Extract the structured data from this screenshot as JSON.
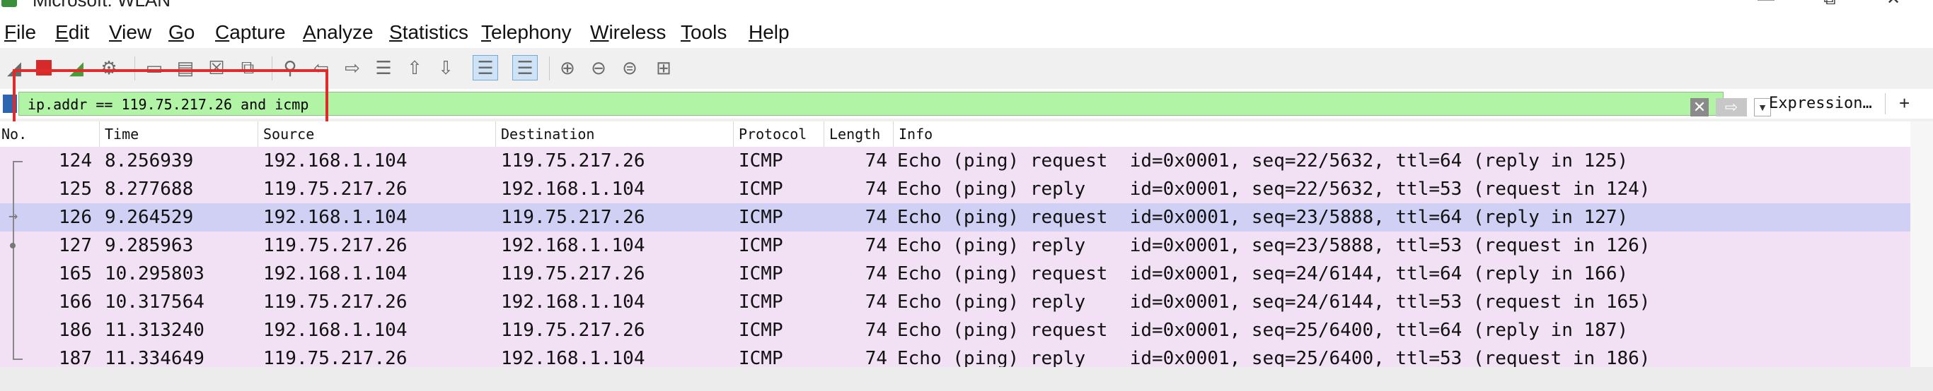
{
  "window": {
    "title": "Microsoft: WLAN",
    "controls": {
      "minimize": "—",
      "maximize": "⧉",
      "close": "✕"
    }
  },
  "menu": [
    "File",
    "Edit",
    "View",
    "Go",
    "Capture",
    "Analyze",
    "Statistics",
    "Telephony",
    "Wireless",
    "Tools",
    "Help"
  ],
  "toolbar": {
    "icons": [
      "shark-fin-start-icon",
      "stop-square-icon",
      "restart-fin-icon",
      "capture-options-gear-icon",
      "open-file-icon",
      "save-file-icon",
      "close-file-icon",
      "reload-file-icon",
      "find-packet-icon",
      "go-back-icon",
      "go-forward-icon",
      "go-to-packet-icon",
      "go-first-icon",
      "go-last-icon",
      "autoscroll-icon",
      "colorize-icon",
      "zoom-in-icon",
      "zoom-out-icon",
      "zoom-normal-icon",
      "resize-columns-icon"
    ],
    "active": [
      "autoscroll-icon",
      "colorize-icon"
    ]
  },
  "filter": {
    "value": "ip.addr == 119.75.217.26 and icmp",
    "expression_label": "Expression…",
    "add_label": "+",
    "background": "#b1f4a5",
    "annotation_color": "#e12a2a"
  },
  "columns": [
    "No.",
    "Time",
    "Source",
    "Destination",
    "Protocol",
    "Length",
    "Info"
  ],
  "packets": [
    {
      "no": "124",
      "time": "8.256939",
      "src": "192.168.1.104",
      "dst": "119.75.217.26",
      "proto": "ICMP",
      "len": "74",
      "info": "Echo (ping) request  id=0x0001, seq=22/5632, ttl=64 (reply in 125)",
      "selected": false,
      "rel": "start"
    },
    {
      "no": "125",
      "time": "8.277688",
      "src": "119.75.217.26",
      "dst": "192.168.1.104",
      "proto": "ICMP",
      "len": "74",
      "info": "Echo (ping) reply    id=0x0001, seq=22/5632, ttl=53 (request in 124)",
      "selected": false,
      "rel": "line"
    },
    {
      "no": "126",
      "time": "9.264529",
      "src": "192.168.1.104",
      "dst": "119.75.217.26",
      "proto": "ICMP",
      "len": "74",
      "info": "Echo (ping) request  id=0x0001, seq=23/5888, ttl=64 (reply in 127)",
      "selected": true,
      "rel": "arrow"
    },
    {
      "no": "127",
      "time": "9.285963",
      "src": "119.75.217.26",
      "dst": "192.168.1.104",
      "proto": "ICMP",
      "len": "74",
      "info": "Echo (ping) reply    id=0x0001, seq=23/5888, ttl=53 (request in 126)",
      "selected": false,
      "rel": "dot"
    },
    {
      "no": "165",
      "time": "10.295803",
      "src": "192.168.1.104",
      "dst": "119.75.217.26",
      "proto": "ICMP",
      "len": "74",
      "info": "Echo (ping) request  id=0x0001, seq=24/6144, ttl=64 (reply in 166)",
      "selected": false,
      "rel": "line"
    },
    {
      "no": "166",
      "time": "10.317564",
      "src": "119.75.217.26",
      "dst": "192.168.1.104",
      "proto": "ICMP",
      "len": "74",
      "info": "Echo (ping) reply    id=0x0001, seq=24/6144, ttl=53 (request in 165)",
      "selected": false,
      "rel": "line"
    },
    {
      "no": "186",
      "time": "11.313240",
      "src": "192.168.1.104",
      "dst": "119.75.217.26",
      "proto": "ICMP",
      "len": "74",
      "info": "Echo (ping) request  id=0x0001, seq=25/6400, ttl=64 (reply in 187)",
      "selected": false,
      "rel": "line"
    },
    {
      "no": "187",
      "time": "11.334649",
      "src": "119.75.217.26",
      "dst": "192.168.1.104",
      "proto": "ICMP",
      "len": "74",
      "info": "Echo (ping) reply    id=0x0001, seq=25/6400, ttl=53 (request in 186)",
      "selected": false,
      "rel": "end"
    }
  ],
  "colors": {
    "row_icmp": "#f2e0f5",
    "row_selected": "#cfd0f4"
  }
}
